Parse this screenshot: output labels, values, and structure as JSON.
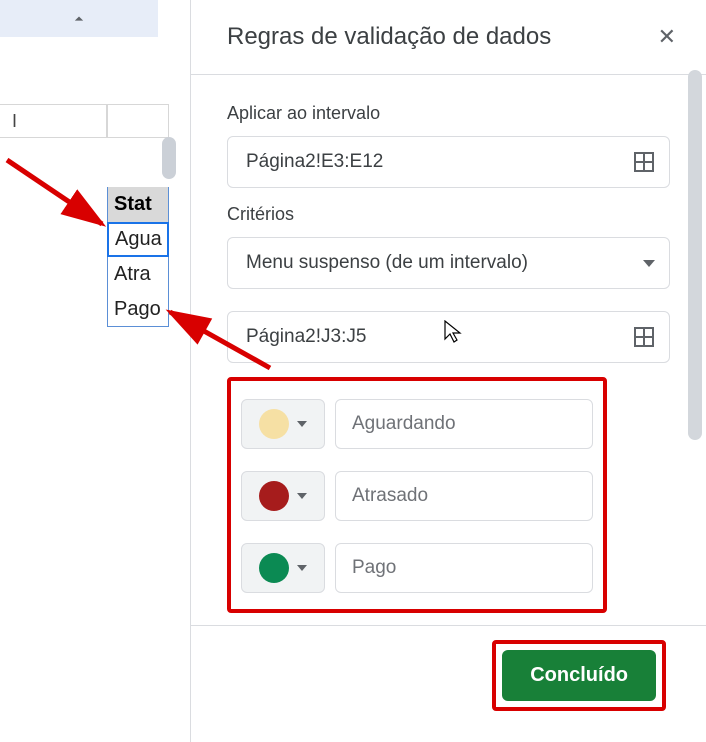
{
  "sheet": {
    "col_left_header": "I",
    "status_header": "Stat",
    "rows": [
      "Agua",
      "Atra",
      "Pago"
    ]
  },
  "panel": {
    "title": "Regras de validação de dados",
    "apply_label": "Aplicar ao intervalo",
    "apply_value": "Página2!E3:E12",
    "criteria_label": "Critérios",
    "criteria_value": "Menu suspenso (de um intervalo)",
    "range2_value": "Página2!J3:J5",
    "options": [
      {
        "color": "#f6e0a4",
        "label": "Aguardando"
      },
      {
        "color": "#a61c1c",
        "label": "Atrasado"
      },
      {
        "color": "#0b8a53",
        "label": "Pago"
      }
    ],
    "done_label": "Concluído"
  }
}
